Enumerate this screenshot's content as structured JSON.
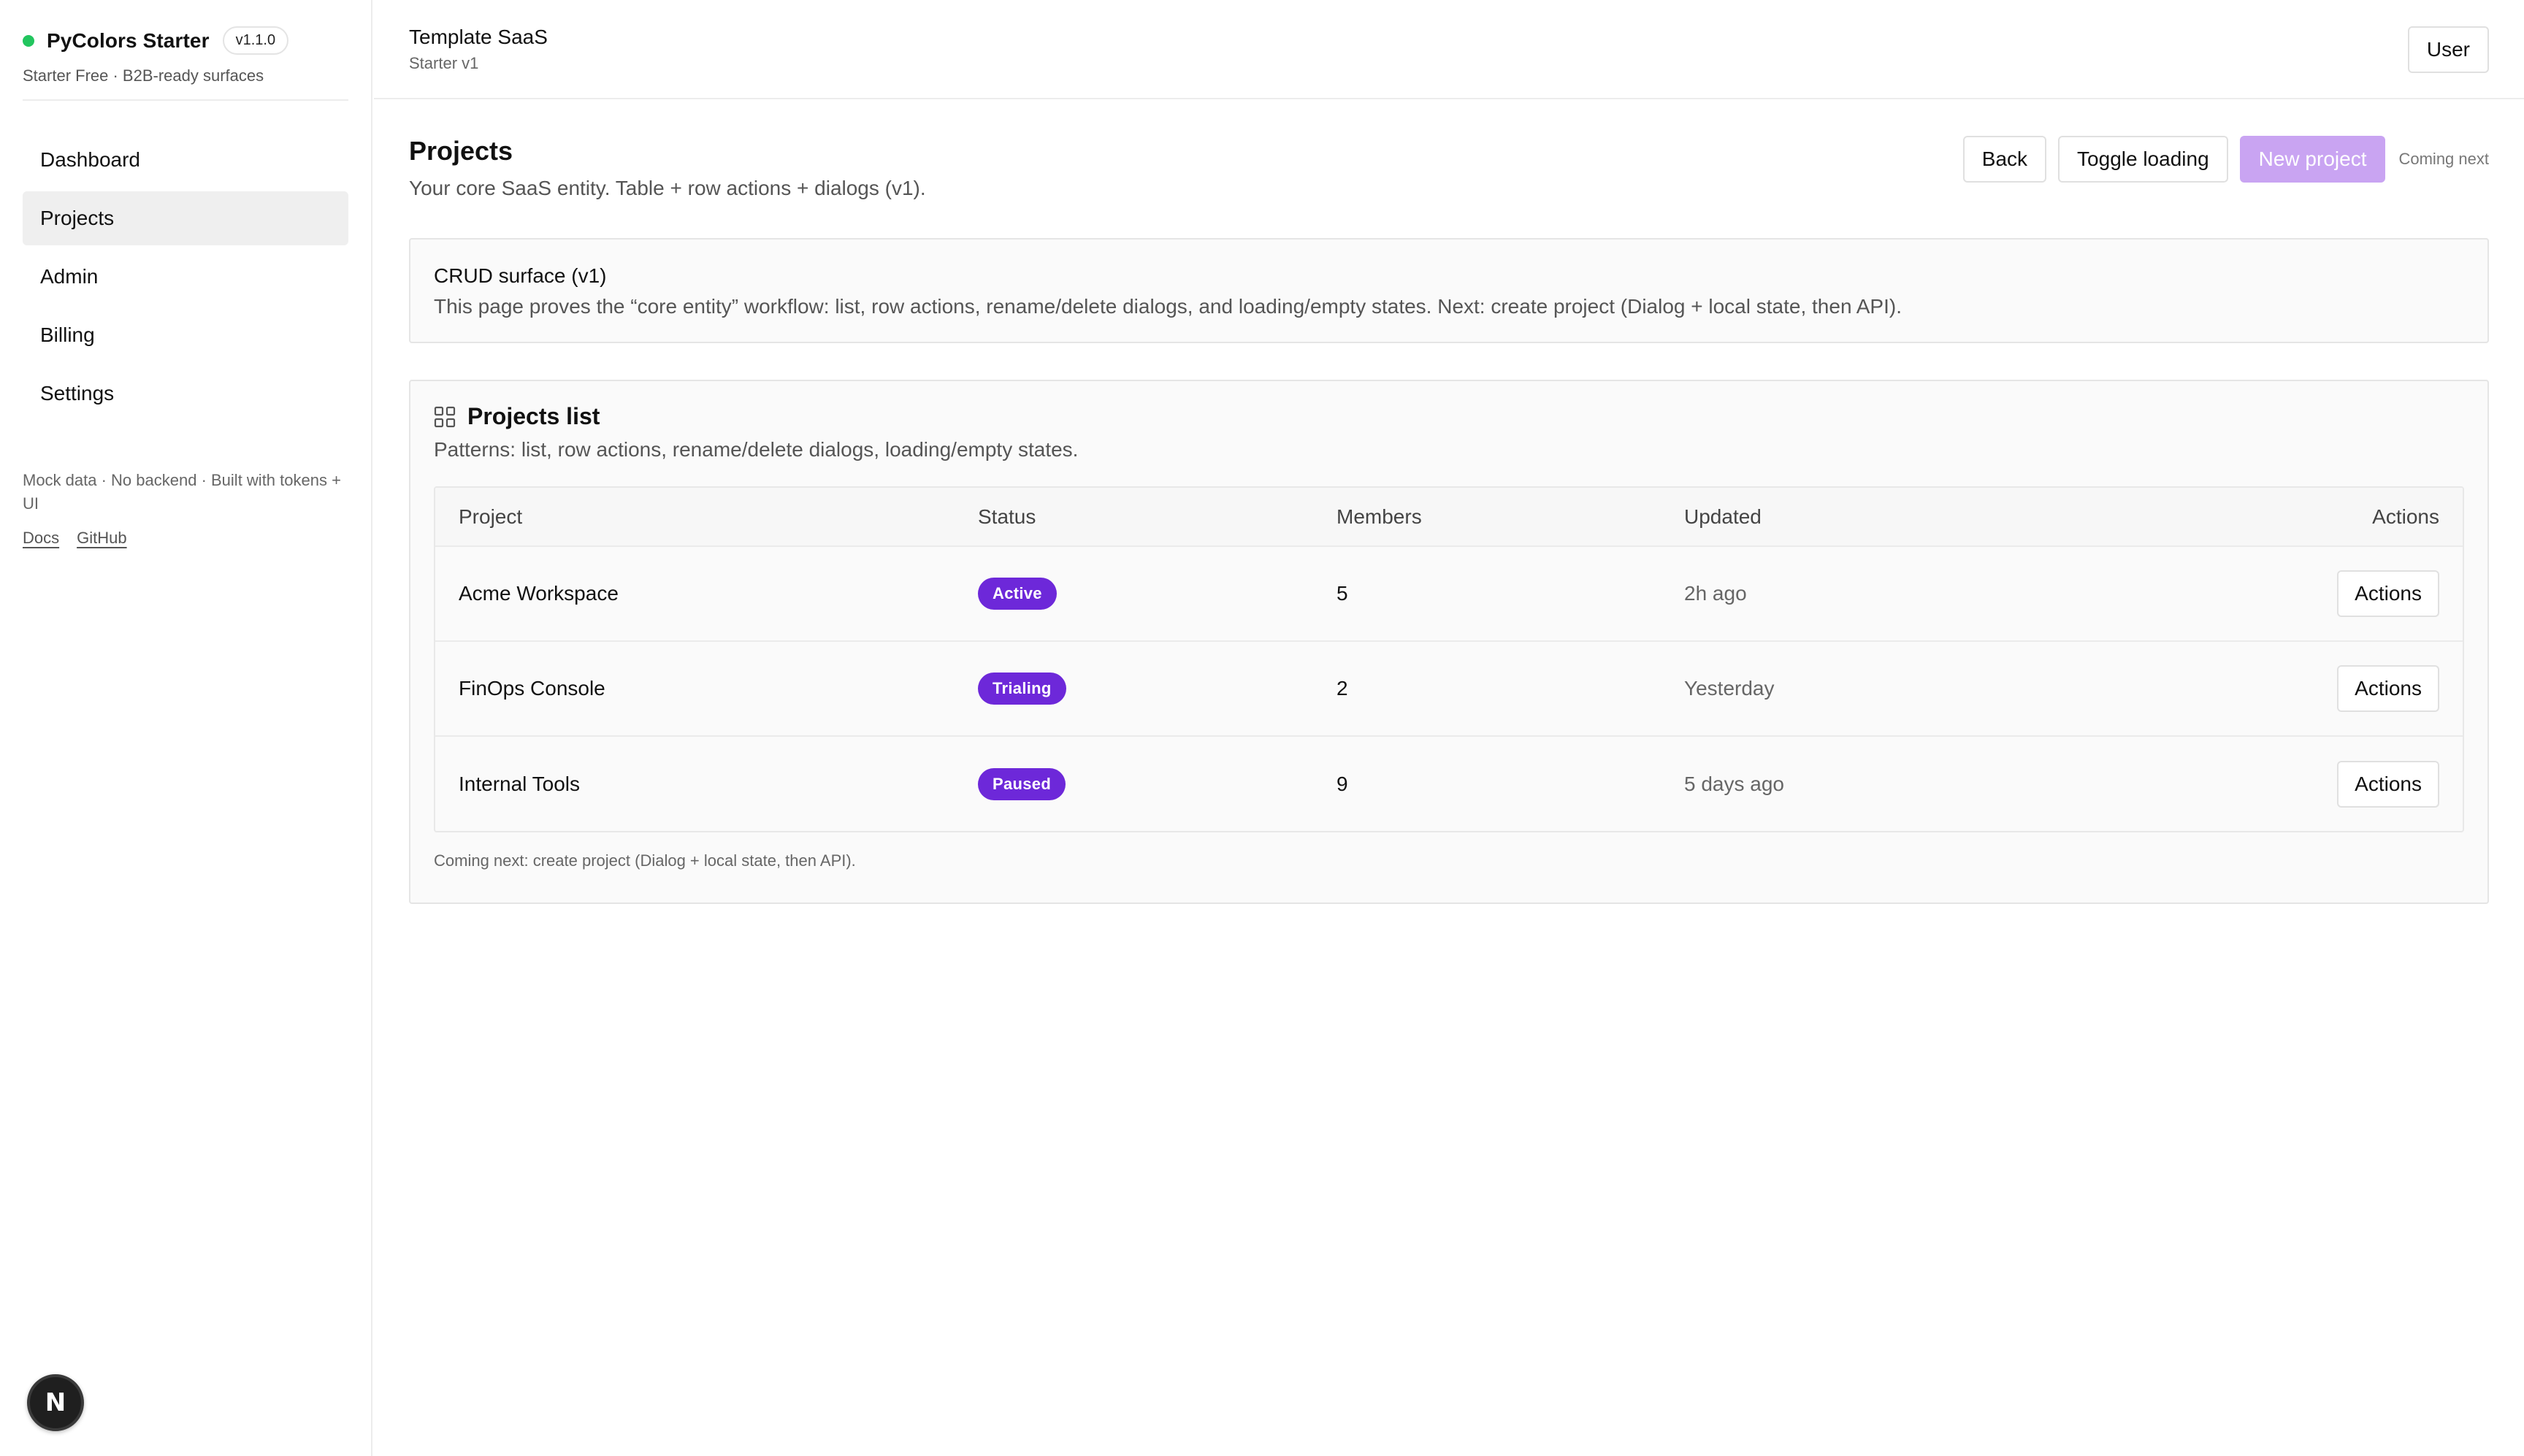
{
  "sidebar": {
    "brand": "PyColors Starter",
    "version": "v1.1.0",
    "subtitle": "Starter Free · B2B-ready surfaces",
    "nav": [
      {
        "label": "Dashboard"
      },
      {
        "label": "Projects"
      },
      {
        "label": "Admin"
      },
      {
        "label": "Billing"
      },
      {
        "label": "Settings"
      }
    ],
    "active_item": "Projects",
    "note": "Mock data · No backend · Built with tokens + UI",
    "links": {
      "docs": "Docs",
      "github": "GitHub"
    },
    "dev_badge": "N"
  },
  "topbar": {
    "title": "Template SaaS",
    "subtitle": "Starter v1",
    "user_label": "User"
  },
  "page": {
    "title": "Projects",
    "subtitle": "Your core SaaS entity. Table + row actions + dialogs (v1).",
    "actions": {
      "back": "Back",
      "toggle_loading": "Toggle loading",
      "new_project": "New project",
      "coming_next": "Coming next"
    }
  },
  "info_card": {
    "title": "CRUD surface (v1)",
    "text": "This page proves the “core entity” workflow: list, row actions, rename/delete dialogs, and loading/empty states. Next: create project (Dialog + local state, then API)."
  },
  "projects_list": {
    "title": "Projects list",
    "subtitle": "Patterns: list, row actions, rename/delete dialogs, loading/empty states.",
    "columns": {
      "project": "Project",
      "status": "Status",
      "members": "Members",
      "updated": "Updated",
      "actions": "Actions"
    },
    "rows": [
      {
        "project": "Acme Workspace",
        "status": "Active",
        "members": "5",
        "updated": "2h ago",
        "action": "Actions"
      },
      {
        "project": "FinOps Console",
        "status": "Trialing",
        "members": "2",
        "updated": "Yesterday",
        "action": "Actions"
      },
      {
        "project": "Internal Tools",
        "status": "Paused",
        "members": "9",
        "updated": "5 days ago",
        "action": "Actions"
      }
    ],
    "footer": "Coming next: create project (Dialog + local state, then API)."
  },
  "colors": {
    "status_dot": "#22c55e",
    "badge": "#6d28d9",
    "primary_disabled": "#c9a4f2"
  },
  "icons": {
    "projects_list": "grid-icon",
    "status": "status-dot-icon"
  }
}
